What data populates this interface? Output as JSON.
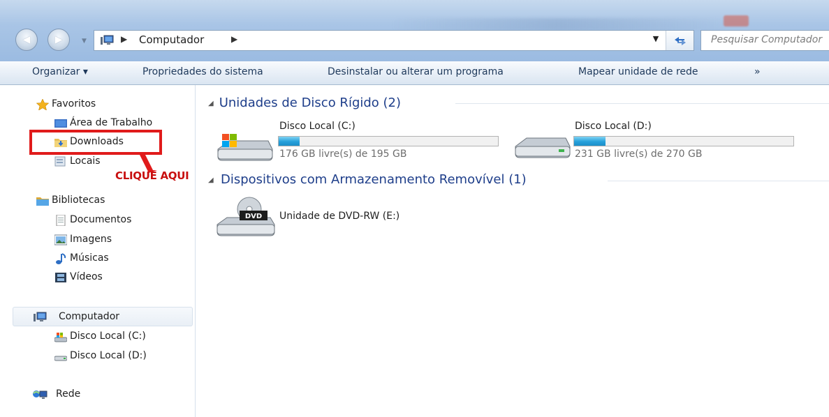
{
  "address_bar": {
    "location": "Computador",
    "search_placeholder": "Pesquisar Computador"
  },
  "command_bar": {
    "organize": "Organizar ▾",
    "system_properties": "Propriedades do sistema",
    "uninstall": "Desinstalar ou alterar um programa",
    "map_drive": "Mapear unidade de rede",
    "more": "»"
  },
  "navigation": {
    "favorites": {
      "label": "Favoritos",
      "items": [
        "Área de Trabalho",
        "Downloads",
        "Locais"
      ]
    },
    "libraries": {
      "label": "Bibliotecas",
      "items": [
        "Documentos",
        "Imagens",
        "Músicas",
        "Vídeos"
      ]
    },
    "computer": {
      "label": "Computador",
      "items": [
        "Disco Local (C:)",
        "Disco Local (D:)"
      ]
    },
    "network": {
      "label": "Rede"
    }
  },
  "content": {
    "hard_disks": {
      "header": "Unidades de Disco Rígido (2)",
      "drives": [
        {
          "name": "Disco Local (C:)",
          "free_text": "176 GB livre(s) de 195 GB",
          "used_fraction": 0.097
        },
        {
          "name": "Disco Local (D:)",
          "free_text": "231 GB livre(s) de 270 GB",
          "used_fraction": 0.144
        }
      ]
    },
    "removable": {
      "header": "Dispositivos com Armazenamento Removível (1)",
      "devices": [
        {
          "name": "Unidade de DVD-RW (E:)",
          "icon_label": "DVD"
        }
      ]
    }
  },
  "annotation": {
    "text": "CLIQUE AQUI"
  },
  "colors": {
    "accent_header": "#1e3e8a",
    "bar_fill": "#26a0da",
    "annotation_red": "#e01b1b"
  }
}
